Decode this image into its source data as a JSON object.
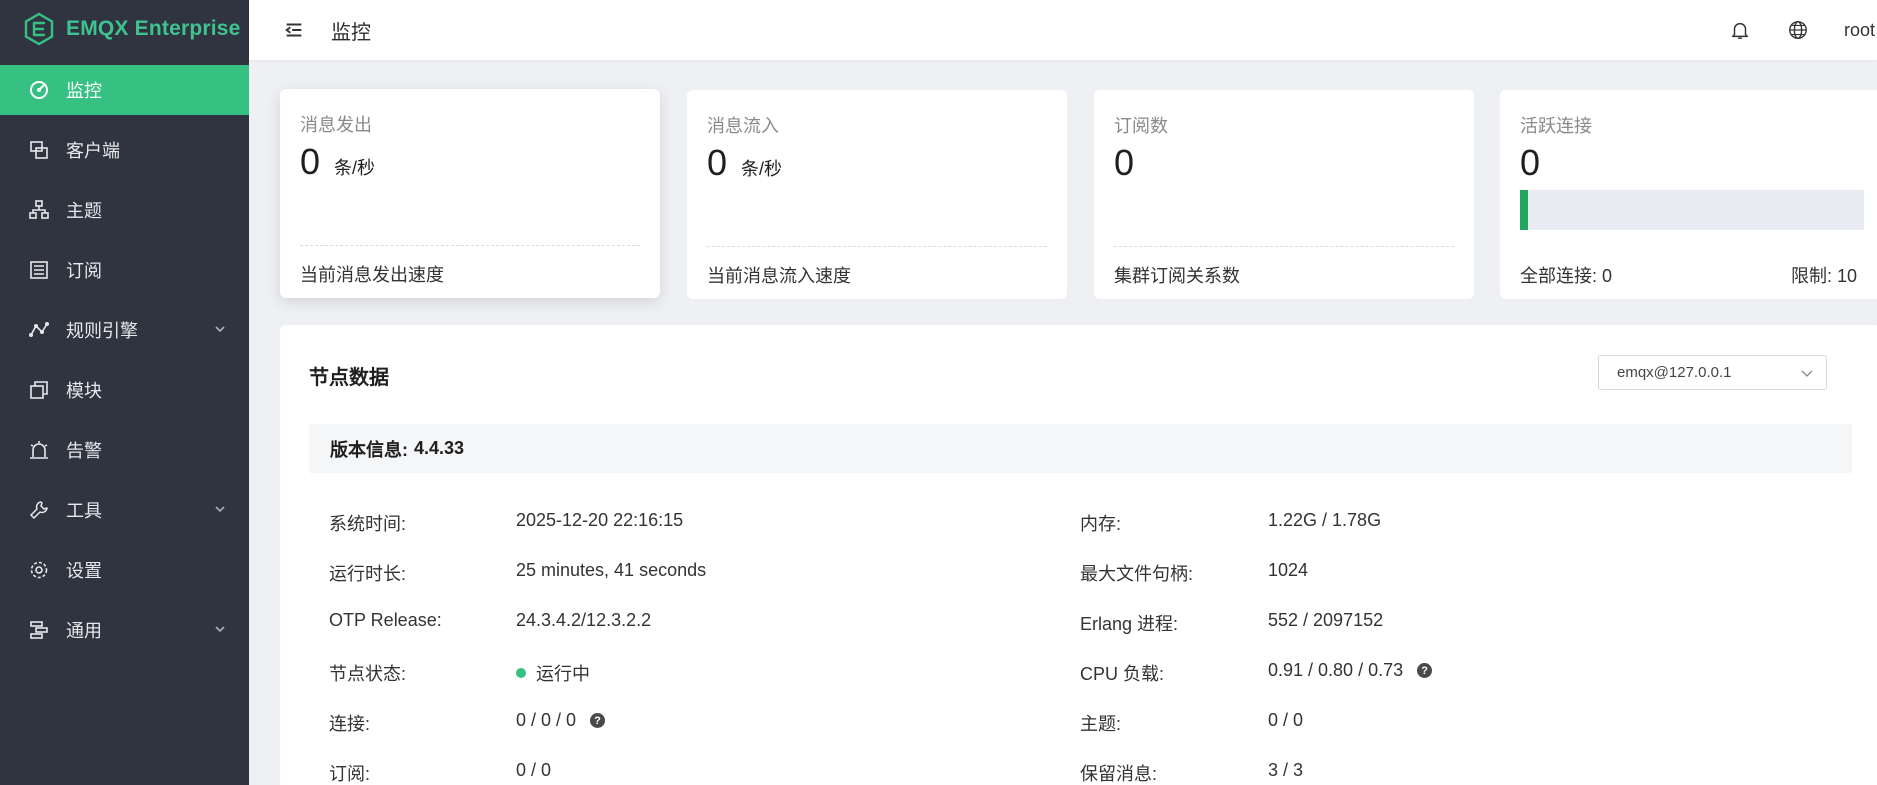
{
  "brand": {
    "name": "EMQX Enterprise",
    "accent": "#36c182"
  },
  "sidebar": {
    "items": [
      {
        "label": "监控",
        "icon": "dashboard-icon",
        "active": true
      },
      {
        "label": "客户端",
        "icon": "clients-icon"
      },
      {
        "label": "主题",
        "icon": "topics-icon"
      },
      {
        "label": "订阅",
        "icon": "subscriptions-icon"
      },
      {
        "label": "规则引擎",
        "icon": "rule-engine-icon",
        "expandable": true
      },
      {
        "label": "模块",
        "icon": "modules-icon"
      },
      {
        "label": "告警",
        "icon": "alarm-icon"
      },
      {
        "label": "工具",
        "icon": "tools-icon",
        "expandable": true
      },
      {
        "label": "设置",
        "icon": "gear-icon"
      },
      {
        "label": "通用",
        "icon": "general-icon",
        "expandable": true
      }
    ]
  },
  "header": {
    "title": "监控",
    "user": "root"
  },
  "cards": {
    "sent": {
      "title": "消息发出",
      "value": "0",
      "unit": "条/秒",
      "foot": "当前消息发出速度"
    },
    "received": {
      "title": "消息流入",
      "value": "0",
      "unit": "条/秒",
      "foot": "当前消息流入速度"
    },
    "subscriptions": {
      "title": "订阅数",
      "value": "0",
      "foot": "集群订阅关系数"
    },
    "connections": {
      "title": "活跃连接",
      "value": "0",
      "total_label": "全部连接: 0",
      "limit_label": "限制: 10",
      "usage_fraction": 0.0
    }
  },
  "node": {
    "title": "节点数据",
    "selected": "emqx@127.0.0.1",
    "version_label": "版本信息:",
    "version": "4.4.33",
    "left": [
      {
        "label": "系统时间:",
        "value": "2025-12-20 22:16:15"
      },
      {
        "label": "运行时长:",
        "value": "25 minutes, 41 seconds"
      },
      {
        "label": "OTP Release:",
        "value": "24.3.4.2/12.3.2.2"
      },
      {
        "label": "节点状态:",
        "value": "运行中"
      },
      {
        "label": "连接:",
        "value": "0 / 0 / 0"
      },
      {
        "label": "订阅:",
        "value": "0 / 0"
      }
    ],
    "right": [
      {
        "label": "内存:",
        "value": "1.22G / 1.78G"
      },
      {
        "label": "最大文件句柄:",
        "value": "1024"
      },
      {
        "label": "Erlang 进程:",
        "value": "552 / 2097152"
      },
      {
        "label": "CPU 负载:",
        "value": "0.91 / 0.80 / 0.73"
      },
      {
        "label": "主题:",
        "value": "0 / 0"
      },
      {
        "label": "保留消息:",
        "value": "3 / 3"
      }
    ],
    "help_glyph": "?"
  }
}
